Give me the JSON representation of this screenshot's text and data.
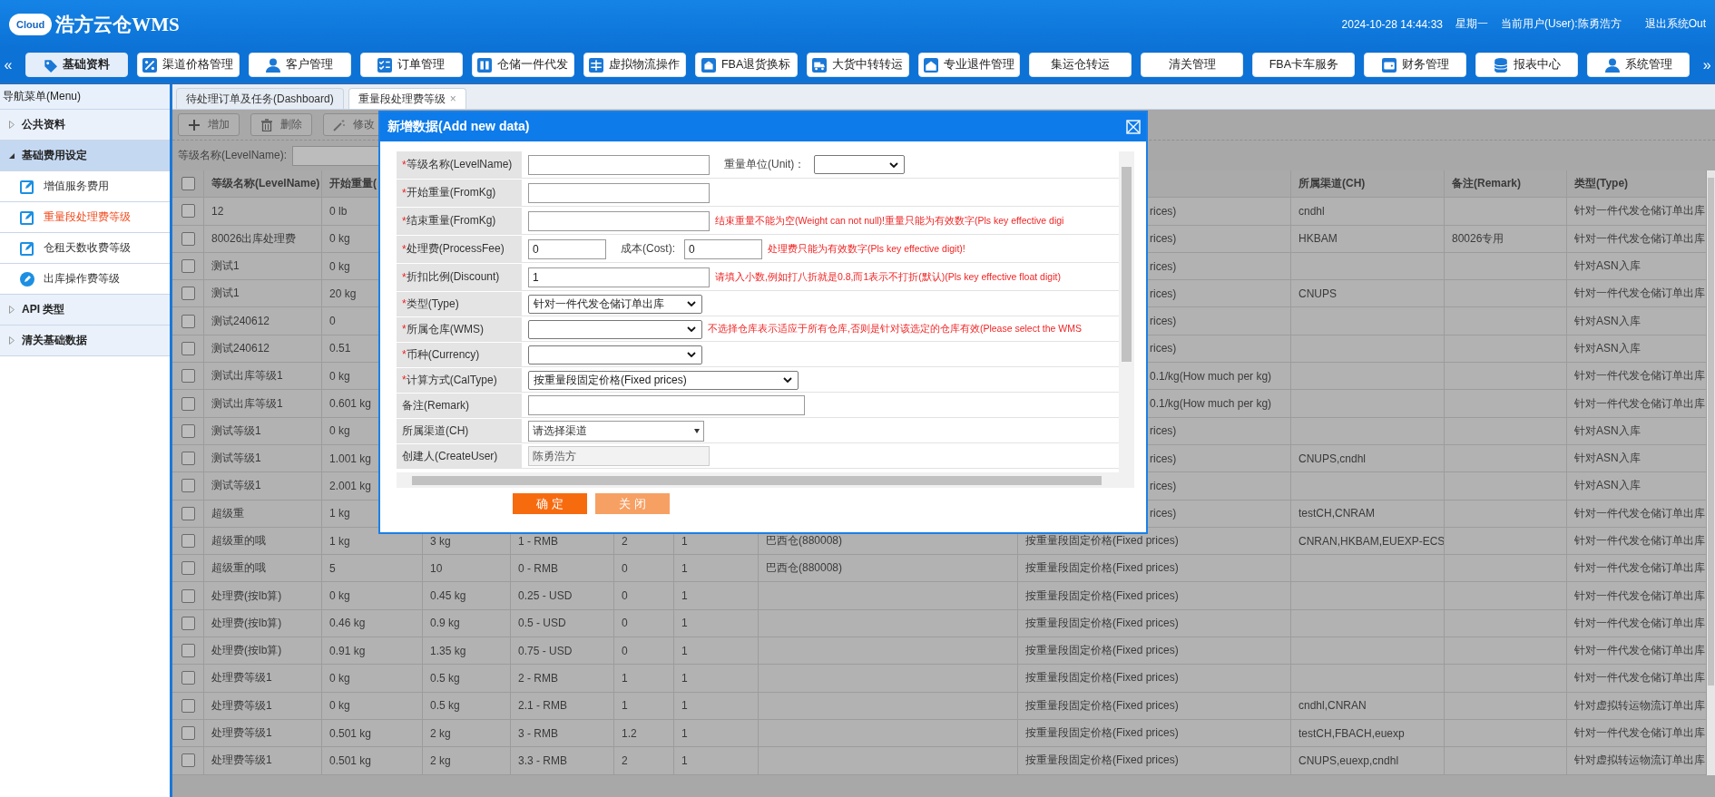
{
  "header": {
    "logo_badge": "Cloud",
    "logo_text": "浩方云仓WMS",
    "datetime": "2024-10-28 14:44:33",
    "weekday": "星期一",
    "user": "当前用户(User):陈勇浩方",
    "logout": "退出系统Out"
  },
  "nav": {
    "scroll_left": "«",
    "scroll_right": "»",
    "items": [
      {
        "label": "基础资料",
        "kind": "tag",
        "selected": true
      },
      {
        "label": "渠道价格管理",
        "kind": "percent",
        "selected": false
      },
      {
        "label": "客户管理",
        "kind": "user",
        "selected": false
      },
      {
        "label": "订单管理",
        "kind": "checklist",
        "selected": false
      },
      {
        "label": "仓储一件代发",
        "kind": "building",
        "selected": false
      },
      {
        "label": "虚拟物流操作",
        "kind": "grid",
        "selected": false
      },
      {
        "label": "FBA退货换标",
        "kind": "box",
        "selected": false
      },
      {
        "label": "大货中转转运",
        "kind": "truck",
        "selected": false
      },
      {
        "label": "专业退件管理",
        "kind": "house",
        "selected": false
      },
      {
        "label": "集运仓转运",
        "kind": "plain",
        "selected": false
      },
      {
        "label": "清关管理",
        "kind": "plain",
        "selected": false
      },
      {
        "label": "FBA卡车服务",
        "kind": "plain",
        "selected": false
      },
      {
        "label": "财务管理",
        "kind": "wallet",
        "selected": false
      },
      {
        "label": "报表中心",
        "kind": "database",
        "selected": false
      },
      {
        "label": "系统管理",
        "kind": "user",
        "selected": false
      }
    ]
  },
  "sidebar": {
    "title": "导航菜单(Menu)",
    "groups": [
      {
        "label": "公共资料",
        "expanded": false
      },
      {
        "label": "基础费用设定",
        "expanded": true,
        "children": [
          {
            "label": "增值服务费用",
            "kind": "edit",
            "selected": false
          },
          {
            "label": "重量段处理费等级",
            "kind": "edit",
            "selected": true
          },
          {
            "label": "仓租天数收费等级",
            "kind": "edit",
            "selected": false
          },
          {
            "label": "出库操作费等级",
            "kind": "disc",
            "selected": false
          }
        ]
      },
      {
        "label": "API 类型",
        "expanded": false
      },
      {
        "label": "清关基础数据",
        "expanded": false
      }
    ]
  },
  "tabs": [
    {
      "label": "待处理订单及任务(Dashboard)",
      "selected": false
    },
    {
      "label": "重量段处理费等级",
      "selected": true,
      "close": "×"
    }
  ],
  "toolbar": [
    {
      "label": "增加",
      "kind": "plus"
    },
    {
      "label": "删除",
      "kind": "trash"
    },
    {
      "label": "修改",
      "kind": "wand"
    }
  ],
  "search": {
    "label": "等级名称(LevelName):"
  },
  "table": {
    "select_all_checked": false,
    "headers": {
      "level_name": "等级名称(LevelName)",
      "from_weight": "开始重量(",
      "channel": "所属渠道(CH)",
      "remark": "备注(Remark)",
      "type": "类型(Type)"
    },
    "rows": [
      {
        "checked": false,
        "covered": true,
        "level_name": "12",
        "from_weight": "0 lb",
        "calc_type": "rices)",
        "channel": "cndhl",
        "type": "针对一件代发仓储订单出库"
      },
      {
        "checked": false,
        "covered": true,
        "level_name": "80026出库处理费",
        "from_weight": "0 kg",
        "calc_type": "rices)",
        "channel": "HKBAM",
        "remark": "80026专用",
        "type": "针对一件代发仓储订单出库"
      },
      {
        "checked": false,
        "covered": true,
        "level_name": "测试1",
        "from_weight": "0 kg",
        "calc_type": "rices)",
        "type": "针对ASN入库"
      },
      {
        "checked": false,
        "covered": true,
        "level_name": "测试1",
        "from_weight": "20 kg",
        "calc_type": "rices)",
        "channel": "CNUPS",
        "type": "针对一件代发仓储订单出库"
      },
      {
        "checked": false,
        "covered": true,
        "level_name": "测试240612",
        "from_weight": "0",
        "calc_type": "rices)",
        "type": "针对ASN入库"
      },
      {
        "checked": false,
        "covered": true,
        "level_name": "测试240612",
        "from_weight": "0.51",
        "calc_type": "rices)",
        "type": "针对ASN入库"
      },
      {
        "checked": false,
        "covered": true,
        "level_name": "测试出库等级1",
        "from_weight": "0 kg",
        "calc_type": "0.1/kg(How much per kg)",
        "type": "针对一件代发仓储订单出库"
      },
      {
        "checked": false,
        "covered": true,
        "level_name": "测试出库等级1",
        "from_weight": "0.601 kg",
        "calc_type": "0.1/kg(How much per kg)",
        "type": "针对一件代发仓储订单出库"
      },
      {
        "checked": false,
        "covered": true,
        "level_name": "测试等级1",
        "from_weight": "0 kg",
        "calc_type": "rices)",
        "type": "针对ASN入库"
      },
      {
        "checked": false,
        "covered": true,
        "level_name": "测试等级1",
        "from_weight": "1.001 kg",
        "calc_type": "rices)",
        "channel": "CNUPS,cndhl",
        "type": "针对ASN入库"
      },
      {
        "checked": false,
        "covered": true,
        "level_name": "测试等级1",
        "from_weight": "2.001 kg",
        "calc_type": "rices)",
        "type": "针对ASN入库"
      },
      {
        "checked": false,
        "covered": true,
        "level_name": "超级重",
        "from_weight": "1 kg",
        "calc_type": "rices)",
        "channel": "testCH,CNRAM",
        "type": "针对一件代发仓储订单出库"
      },
      {
        "checked": false,
        "covered": false,
        "level_name": "超级重的哦",
        "from_weight": "1 kg",
        "to_weight": "3 kg",
        "fee": "1 - RMB",
        "cost": "2",
        "discount": "1",
        "warehouse": "巴西仓(880008)",
        "calc_type": "按重量段固定价格(Fixed prices)",
        "channel": "CNRAN,HKBAM,EUEXP-ECS",
        "type": "针对一件代发仓储订单出库"
      },
      {
        "checked": false,
        "covered": false,
        "level_name": "超级重的哦",
        "from_weight": "5",
        "to_weight": "10",
        "fee": "0 - RMB",
        "cost": "0",
        "discount": "1",
        "warehouse": "巴西仓(880008)",
        "calc_type": "按重量段固定价格(Fixed prices)",
        "type": "针对一件代发仓储订单出库"
      },
      {
        "checked": false,
        "covered": false,
        "level_name": "处理费(按lb算)",
        "from_weight": "0 kg",
        "to_weight": "0.45 kg",
        "fee": "0.25 - USD",
        "cost": "0",
        "discount": "1",
        "calc_type": "按重量段固定价格(Fixed prices)",
        "type": "针对一件代发仓储订单出库"
      },
      {
        "checked": false,
        "covered": false,
        "level_name": "处理费(按lb算)",
        "from_weight": "0.46 kg",
        "to_weight": "0.9 kg",
        "fee": "0.5 - USD",
        "cost": "0",
        "discount": "1",
        "calc_type": "按重量段固定价格(Fixed prices)",
        "type": "针对一件代发仓储订单出库"
      },
      {
        "checked": false,
        "covered": false,
        "level_name": "处理费(按lb算)",
        "from_weight": "0.91 kg",
        "to_weight": "1.35 kg",
        "fee": "0.75 - USD",
        "cost": "0",
        "discount": "1",
        "calc_type": "按重量段固定价格(Fixed prices)",
        "type": "针对一件代发仓储订单出库"
      },
      {
        "checked": false,
        "covered": false,
        "level_name": "处理费等级1",
        "from_weight": "0 kg",
        "to_weight": "0.5 kg",
        "fee": "2 - RMB",
        "cost": "1",
        "discount": "1",
        "calc_type": "按重量段固定价格(Fixed prices)",
        "type": "针对一件代发仓储订单出库"
      },
      {
        "checked": false,
        "covered": false,
        "level_name": "处理费等级1",
        "from_weight": "0 kg",
        "to_weight": "0.5 kg",
        "fee": "2.1 - RMB",
        "cost": "1",
        "discount": "1",
        "calc_type": "按重量段固定价格(Fixed prices)",
        "channel": "cndhl,CNRAN",
        "type": "针对虚拟转运物流订单出库"
      },
      {
        "checked": false,
        "covered": false,
        "level_name": "处理费等级1",
        "from_weight": "0.501 kg",
        "to_weight": "2 kg",
        "fee": "3 - RMB",
        "cost": "1.2",
        "discount": "1",
        "calc_type": "按重量段固定价格(Fixed prices)",
        "channel": "testCH,FBACH,euexp",
        "type": "针对一件代发仓储订单出库"
      },
      {
        "checked": false,
        "covered": false,
        "level_name": "处理费等级1",
        "from_weight": "0.501 kg",
        "to_weight": "2 kg",
        "fee": "3.3 - RMB",
        "cost": "2",
        "discount": "1",
        "calc_type": "按重量段固定价格(Fixed prices)",
        "channel": "CNUPS,euexp,cndhl",
        "type": "针对虚拟转运物流订单出库"
      }
    ]
  },
  "dialog": {
    "title": "新增数据(Add new data)",
    "form": [
      {
        "mark": "*",
        "label": "等级名称(LevelName)",
        "fields": [
          {
            "kind": "input"
          },
          {
            "kind": "text",
            "text": "重量单位(Unit)："
          },
          {
            "kind": "select"
          }
        ]
      },
      {
        "mark": "*",
        "label": "开始重量(FromKg)",
        "fields": [
          {
            "kind": "input"
          }
        ]
      },
      {
        "mark": "*",
        "label": "结束重量(FromKg)",
        "fields": [
          {
            "kind": "input"
          },
          {
            "kind": "error",
            "text": "结束重量不能为空(Weight can not null)!重量只能为有效数字(Pls key effective digi"
          }
        ]
      },
      {
        "mark": "*",
        "label": "处理费(ProcessFee)",
        "fields": [
          {
            "kind": "input",
            "value": "0"
          },
          {
            "kind": "text",
            "text": "成本(Cost):"
          },
          {
            "kind": "input",
            "value": "0"
          },
          {
            "kind": "error",
            "text": "处理费只能为有效数字(Pls key effective digit)!"
          }
        ]
      },
      {
        "mark": "*",
        "label": "折扣比例(Discount)",
        "fields": [
          {
            "kind": "input",
            "value": "1"
          },
          {
            "kind": "error",
            "text": "请填入小数,例如打八折就是0.8,而1表示不打折(默认)(Pls key effective float digit)"
          }
        ]
      },
      {
        "mark": "*",
        "label": "类型(Type)",
        "fields": [
          {
            "kind": "select",
            "value": "针对一件代发仓储订单出库"
          }
        ]
      },
      {
        "mark": "*",
        "label": "所属仓库(WMS)",
        "fields": [
          {
            "kind": "select"
          },
          {
            "kind": "error",
            "text": "不选择仓库表示适应于所有仓库,否则是针对该选定的仓库有效(Please select the WMS"
          }
        ]
      },
      {
        "mark": "*",
        "label": "币种(Currency)",
        "fields": [
          {
            "kind": "select"
          }
        ]
      },
      {
        "mark": "*",
        "label": "计算方式(CalType)",
        "fields": [
          {
            "kind": "select",
            "value": "按重量段固定价格(Fixed prices)"
          }
        ]
      },
      {
        "label": "备注(Remark)",
        "fields": [
          {
            "kind": "input"
          }
        ]
      },
      {
        "label": "所属渠道(CH)",
        "fields": [
          {
            "kind": "picker",
            "value": "请选择渠道"
          }
        ]
      },
      {
        "label": "创建人(CreateUser)",
        "fields": [
          {
            "kind": "readonly",
            "value": "陈勇浩方"
          }
        ]
      }
    ],
    "buttons": [
      {
        "label": "确 定",
        "kind": "primary"
      },
      {
        "label": "关 闭",
        "kind": "secondary"
      }
    ]
  }
}
